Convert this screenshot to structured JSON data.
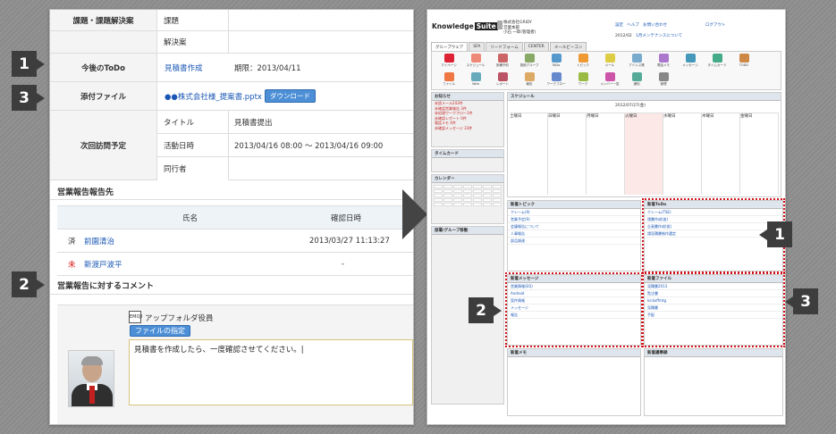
{
  "left": {
    "rows": [
      {
        "label": "課題・課題解決案",
        "sub": "課題",
        "value": ""
      },
      {
        "label": "",
        "sub": "解決案",
        "value": ""
      },
      {
        "label": "今後のToDo",
        "todo_link": "見積書作成",
        "todo_due": "期限：2013/04/11"
      },
      {
        "label": "添付ファイル",
        "file_link": "●●株式会社様_提案書.pptx",
        "file_btn": "ダウンロード"
      }
    ],
    "next_visit": {
      "label": "次回訪問予定",
      "fields": [
        {
          "sub": "タイトル",
          "value": "見積書提出"
        },
        {
          "sub": "活動日時",
          "value": "2013/04/16 08:00 〜 2013/04/16 09:00"
        },
        {
          "sub": "同行者",
          "value": ""
        }
      ]
    },
    "report_dest": {
      "title": "営業報告報告先",
      "col_name": "氏名",
      "col_date": "確認日時",
      "rows": [
        {
          "status": "済",
          "name": "前園清治",
          "date": "2013/03/27 11:13:27"
        },
        {
          "status": "未",
          "name": "新渡戸波平",
          "date": "-"
        }
      ]
    },
    "comment": {
      "title": "営業報告に対するコメント",
      "emoji_label": "EMOJI",
      "author": "アップフォルダ役員",
      "file_btn": "ファイルの指定",
      "text": "見積書を作成したら、一度確認させてください。|"
    }
  },
  "markers": [
    "1",
    "3",
    "2",
    "1",
    "2",
    "3"
  ],
  "right": {
    "logo": "Knowledge",
    "logo_suite": "Suite",
    "company": "株式会社GRIDY",
    "dept": "営業本部",
    "user": "小石 一郎(管理者)",
    "date": "2012/02",
    "notice": "1月メンテナンスについて",
    "top_links": [
      "設定",
      "ヘルプ",
      "お問い合わせ",
      "ログアウト"
    ],
    "tabs": [
      "グループウェア",
      "SFA",
      "リードフォーム",
      "CENTER",
      "メールビーコン"
    ],
    "icons": [
      "マイページ",
      "スケジュール",
      "設備予約",
      "施設グループ",
      "ToDo",
      "トピック",
      "メール",
      "アドレス帳",
      "電話メモ",
      "メッセージ",
      "タイムカード",
      "TODO",
      "ファイル",
      "Web",
      "レポート",
      "報告",
      "ワークフロー",
      "ワーク",
      "メンバー一覧",
      "通知",
      "管理"
    ],
    "side_titles": [
      "お知らせ",
      "タイムカード",
      "カレンダー",
      "部署/グループ移動"
    ],
    "side_notices": [
      "未読メール243件",
      "未確認営業報告 3件",
      "未処理ワークフロー1件",
      "未確認レポート 0件",
      "電話メモ 4件",
      "未確認メッセージ 23件"
    ],
    "schedule_title": "スケジュール",
    "schedule_date": "2012/07/27(金)",
    "days": [
      "土曜日",
      "日曜日",
      "月曜日",
      "火曜日",
      "水曜日",
      "木曜日",
      "金曜日"
    ],
    "widget_titles": [
      "新着トピック",
      "新着ToDo",
      "新着メッセージ",
      "新着ファイル",
      "新着メモ",
      "新着議事録"
    ],
    "topic_rows": [
      "クレーム(9) ",
      "営業予定(9) ",
      "会議報告について",
      "人事報告",
      "部品調達"
    ],
    "todo_rows": [
      "クレーム(TSE)",
      "請書作成(仮)",
      "企画書作成(仮)",
      "請見積書制作選定"
    ],
    "msg_rows": [
      "営業情報(EQ)",
      "Android",
      "案件情報",
      "メッセージ",
      "報告"
    ],
    "file_rows": [
      "見積書2013",
      "覧注書",
      "kickoffmtg",
      "見積書",
      "手配"
    ]
  }
}
